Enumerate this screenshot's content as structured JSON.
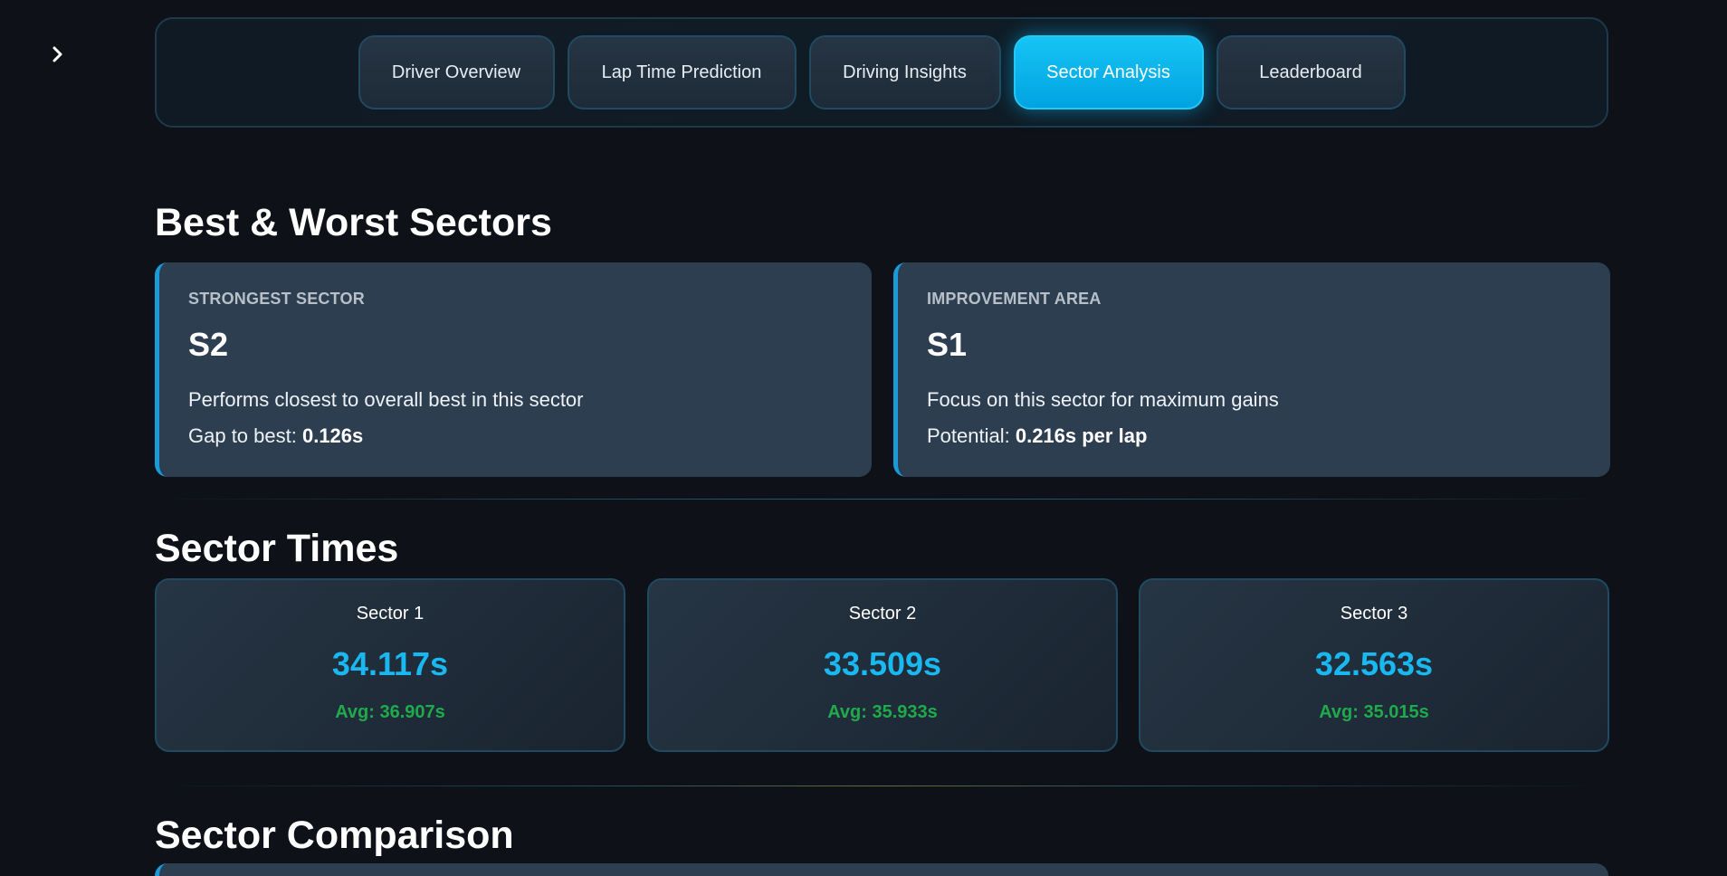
{
  "sidebar": {
    "toggle_icon": "chevron-right-icon"
  },
  "tabs": [
    {
      "label": "Driver Overview"
    },
    {
      "label": "Lap Time Prediction"
    },
    {
      "label": "Driving Insights"
    },
    {
      "label": "Sector Analysis",
      "active": true
    },
    {
      "label": "Leaderboard"
    }
  ],
  "best_worst": {
    "title": "Best & Worst Sectors",
    "strongest": {
      "label": "STRONGEST SECTOR",
      "value": "S2",
      "description": "Performs closest to overall best in this sector",
      "metric_label": "Gap to best: ",
      "metric_value": "0.126s"
    },
    "improvement": {
      "label": "IMPROVEMENT AREA",
      "value": "S1",
      "description": "Focus on this sector for maximum gains",
      "metric_label": "Potential: ",
      "metric_value": "0.216s per lap"
    }
  },
  "sector_times": {
    "title": "Sector Times",
    "sectors": [
      {
        "name": "Sector 1",
        "time": "34.117s",
        "avg": "Avg: 36.907s"
      },
      {
        "name": "Sector 2",
        "time": "33.509s",
        "avg": "Avg: 35.933s"
      },
      {
        "name": "Sector 3",
        "time": "32.563s",
        "avg": "Avg: 35.015s"
      }
    ]
  },
  "sector_comparison": {
    "title": "Sector Comparison"
  },
  "colors": {
    "background": "#0e1117",
    "accent": "#1ab8f0",
    "active_tab": "#00a3e0",
    "card": "#2c3e50",
    "avg_green": "#1faa4c"
  }
}
